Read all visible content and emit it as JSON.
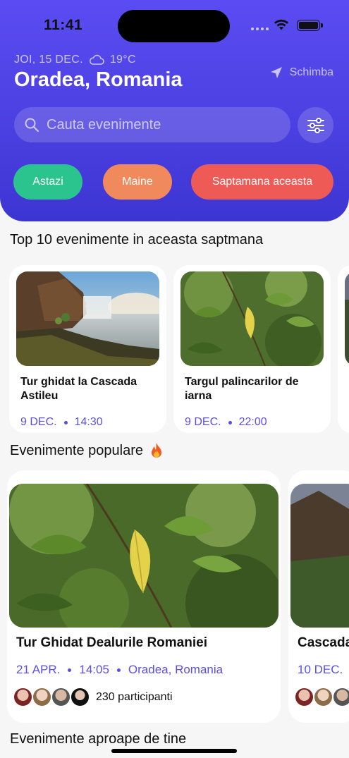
{
  "status_bar": {
    "time": "11:41"
  },
  "header": {
    "date": "JOI, 15 DEC.",
    "temperature": "19°C",
    "weather_icon": "cloud-icon",
    "city": "Oradea, Romania",
    "change_label": "Schimba",
    "change_icon": "location-arrow-icon"
  },
  "search": {
    "placeholder": "Cauta evenimente",
    "icon": "search-icon",
    "filter_icon": "sliders-icon"
  },
  "filters": [
    {
      "label": "Astazi",
      "color": "#2bc48f"
    },
    {
      "label": "Maine",
      "color": "#f08a5d"
    },
    {
      "label": "Saptamana aceasta",
      "color": "#ee5b57"
    }
  ],
  "top10": {
    "title": "Top 10 evenimente in aceasta saptmana",
    "items": [
      {
        "title": "Tur ghidat la Cascada Astileu",
        "date": "9 DEC.",
        "time": "14:30"
      },
      {
        "title": "Targul palincarilor de iarna",
        "date": "9 DEC.",
        "time": "22:00"
      }
    ]
  },
  "popular": {
    "title": "Evenimente populare",
    "title_icon": "fire-icon",
    "items": [
      {
        "title": "Tur Ghidat Dealurile Romaniei",
        "date": "21 APR.",
        "time": "14:05",
        "location": "Oradea, Romania",
        "participants": "230 participanti"
      },
      {
        "title": "Cascada",
        "date": "10 DEC."
      }
    ]
  },
  "nearby": {
    "title": "Evenimente aproape de tine"
  },
  "colors": {
    "accent": "#5b4fe0",
    "header": "#4a3fe0"
  }
}
